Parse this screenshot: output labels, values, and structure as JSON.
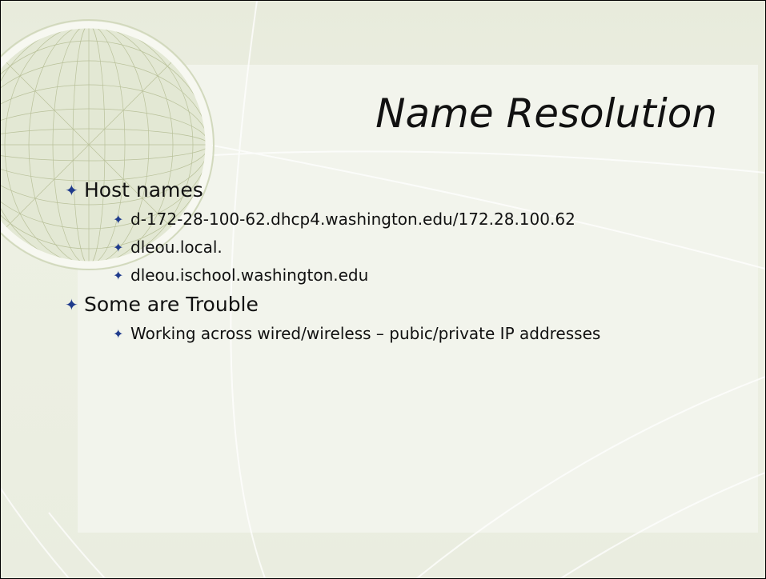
{
  "slide": {
    "title": "Name Resolution",
    "bullets": [
      {
        "text": "Host names",
        "children": [
          "d-172-28-100-62.dhcp4.washington.edu/172.28.100.62",
          "dleou.local.",
          "dleou.ischool.washington.edu"
        ]
      },
      {
        "text": "Some are Trouble",
        "children": [
          "Working across wired/wireless – pubic/private IP addresses"
        ]
      }
    ]
  },
  "icons": {
    "bullet": "four-point-star-icon",
    "decoration": "wireframe-globe-icon"
  },
  "colors": {
    "bullet": "#1f3b8c",
    "background": "#e8ebdc",
    "panel": "#f2f4ec",
    "text": "#111111"
  }
}
